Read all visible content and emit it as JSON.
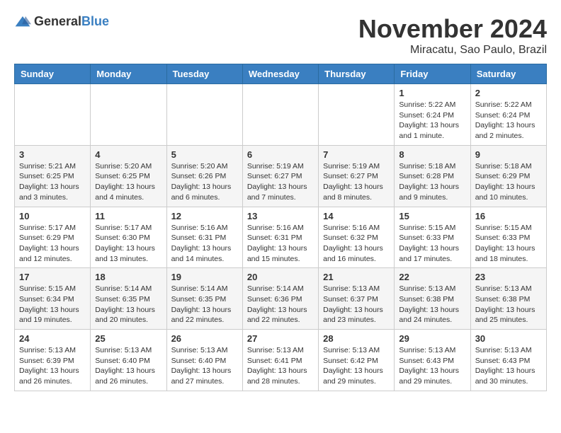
{
  "header": {
    "logo_general": "General",
    "logo_blue": "Blue",
    "month_title": "November 2024",
    "location": "Miracatu, Sao Paulo, Brazil"
  },
  "days_of_week": [
    "Sunday",
    "Monday",
    "Tuesday",
    "Wednesday",
    "Thursday",
    "Friday",
    "Saturday"
  ],
  "weeks": [
    [
      {
        "day": "",
        "info": ""
      },
      {
        "day": "",
        "info": ""
      },
      {
        "day": "",
        "info": ""
      },
      {
        "day": "",
        "info": ""
      },
      {
        "day": "",
        "info": ""
      },
      {
        "day": "1",
        "info": "Sunrise: 5:22 AM\nSunset: 6:24 PM\nDaylight: 13 hours and 1 minute."
      },
      {
        "day": "2",
        "info": "Sunrise: 5:22 AM\nSunset: 6:24 PM\nDaylight: 13 hours and 2 minutes."
      }
    ],
    [
      {
        "day": "3",
        "info": "Sunrise: 5:21 AM\nSunset: 6:25 PM\nDaylight: 13 hours and 3 minutes."
      },
      {
        "day": "4",
        "info": "Sunrise: 5:20 AM\nSunset: 6:25 PM\nDaylight: 13 hours and 4 minutes."
      },
      {
        "day": "5",
        "info": "Sunrise: 5:20 AM\nSunset: 6:26 PM\nDaylight: 13 hours and 6 minutes."
      },
      {
        "day": "6",
        "info": "Sunrise: 5:19 AM\nSunset: 6:27 PM\nDaylight: 13 hours and 7 minutes."
      },
      {
        "day": "7",
        "info": "Sunrise: 5:19 AM\nSunset: 6:27 PM\nDaylight: 13 hours and 8 minutes."
      },
      {
        "day": "8",
        "info": "Sunrise: 5:18 AM\nSunset: 6:28 PM\nDaylight: 13 hours and 9 minutes."
      },
      {
        "day": "9",
        "info": "Sunrise: 5:18 AM\nSunset: 6:29 PM\nDaylight: 13 hours and 10 minutes."
      }
    ],
    [
      {
        "day": "10",
        "info": "Sunrise: 5:17 AM\nSunset: 6:29 PM\nDaylight: 13 hours and 12 minutes."
      },
      {
        "day": "11",
        "info": "Sunrise: 5:17 AM\nSunset: 6:30 PM\nDaylight: 13 hours and 13 minutes."
      },
      {
        "day": "12",
        "info": "Sunrise: 5:16 AM\nSunset: 6:31 PM\nDaylight: 13 hours and 14 minutes."
      },
      {
        "day": "13",
        "info": "Sunrise: 5:16 AM\nSunset: 6:31 PM\nDaylight: 13 hours and 15 minutes."
      },
      {
        "day": "14",
        "info": "Sunrise: 5:16 AM\nSunset: 6:32 PM\nDaylight: 13 hours and 16 minutes."
      },
      {
        "day": "15",
        "info": "Sunrise: 5:15 AM\nSunset: 6:33 PM\nDaylight: 13 hours and 17 minutes."
      },
      {
        "day": "16",
        "info": "Sunrise: 5:15 AM\nSunset: 6:33 PM\nDaylight: 13 hours and 18 minutes."
      }
    ],
    [
      {
        "day": "17",
        "info": "Sunrise: 5:15 AM\nSunset: 6:34 PM\nDaylight: 13 hours and 19 minutes."
      },
      {
        "day": "18",
        "info": "Sunrise: 5:14 AM\nSunset: 6:35 PM\nDaylight: 13 hours and 20 minutes."
      },
      {
        "day": "19",
        "info": "Sunrise: 5:14 AM\nSunset: 6:35 PM\nDaylight: 13 hours and 22 minutes."
      },
      {
        "day": "20",
        "info": "Sunrise: 5:14 AM\nSunset: 6:36 PM\nDaylight: 13 hours and 22 minutes."
      },
      {
        "day": "21",
        "info": "Sunrise: 5:13 AM\nSunset: 6:37 PM\nDaylight: 13 hours and 23 minutes."
      },
      {
        "day": "22",
        "info": "Sunrise: 5:13 AM\nSunset: 6:38 PM\nDaylight: 13 hours and 24 minutes."
      },
      {
        "day": "23",
        "info": "Sunrise: 5:13 AM\nSunset: 6:38 PM\nDaylight: 13 hours and 25 minutes."
      }
    ],
    [
      {
        "day": "24",
        "info": "Sunrise: 5:13 AM\nSunset: 6:39 PM\nDaylight: 13 hours and 26 minutes."
      },
      {
        "day": "25",
        "info": "Sunrise: 5:13 AM\nSunset: 6:40 PM\nDaylight: 13 hours and 26 minutes."
      },
      {
        "day": "26",
        "info": "Sunrise: 5:13 AM\nSunset: 6:40 PM\nDaylight: 13 hours and 27 minutes."
      },
      {
        "day": "27",
        "info": "Sunrise: 5:13 AM\nSunset: 6:41 PM\nDaylight: 13 hours and 28 minutes."
      },
      {
        "day": "28",
        "info": "Sunrise: 5:13 AM\nSunset: 6:42 PM\nDaylight: 13 hours and 29 minutes."
      },
      {
        "day": "29",
        "info": "Sunrise: 5:13 AM\nSunset: 6:43 PM\nDaylight: 13 hours and 29 minutes."
      },
      {
        "day": "30",
        "info": "Sunrise: 5:13 AM\nSunset: 6:43 PM\nDaylight: 13 hours and 30 minutes."
      }
    ]
  ]
}
